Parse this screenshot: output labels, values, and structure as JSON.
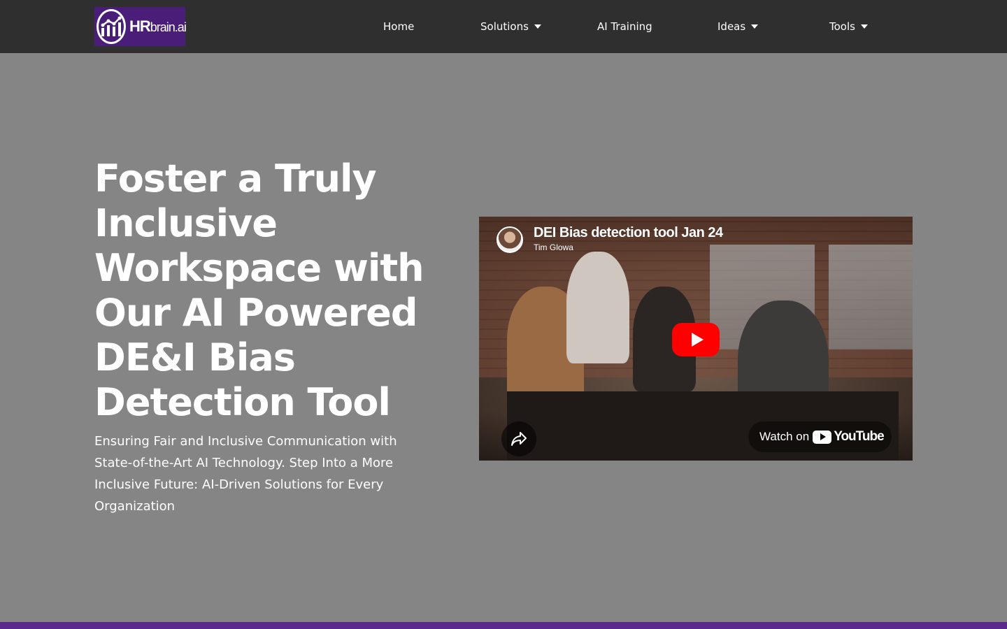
{
  "brand": {
    "logo_bold": "HR",
    "logo_light": "brain.ai",
    "logo_color": "#4a1d78"
  },
  "nav": {
    "items": [
      {
        "label": "Home",
        "has_dropdown": false
      },
      {
        "label": "Solutions",
        "has_dropdown": true
      },
      {
        "label": "AI Training",
        "has_dropdown": false
      },
      {
        "label": "Ideas",
        "has_dropdown": true
      },
      {
        "label": "Tools",
        "has_dropdown": true
      }
    ]
  },
  "hero": {
    "title": "Foster a Truly Inclusive Workspace with Our AI Powered DE&I Bias Detection Tool",
    "subtitle": "Ensuring Fair and Inclusive Communication with State-of-the-Art AI Technology. Step Into a More Inclusive Future: AI-Driven Solutions for Every Organization"
  },
  "video": {
    "title": "DEI Bias detection tool Jan 24",
    "author": "Tim Glowa",
    "watch_on_label": "Watch on",
    "platform_name": "YouTube",
    "play_icon": "play-icon",
    "share_icon": "share-icon"
  },
  "colors": {
    "nav_bg": "#2f2f2f",
    "page_bg": "#858585",
    "accent_bar": "#5a2a8c",
    "play_red": "#ff0000"
  }
}
